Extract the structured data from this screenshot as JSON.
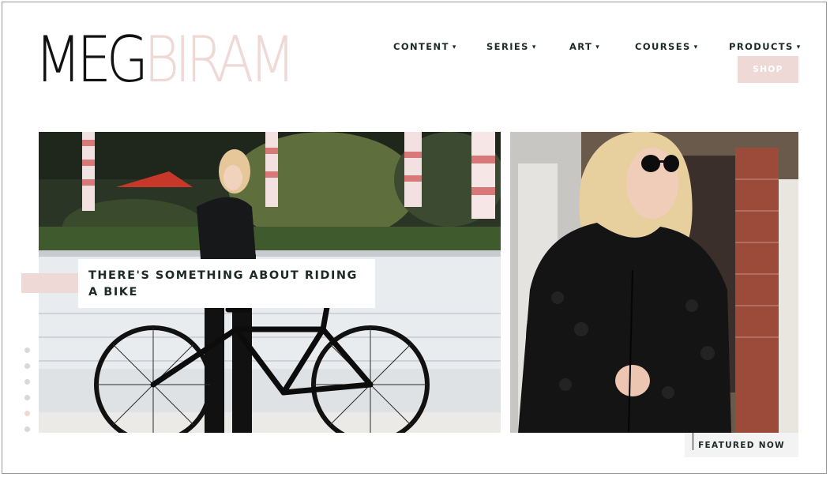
{
  "logo": {
    "first": "MEG",
    "last": "BIRAM"
  },
  "nav": {
    "items": [
      {
        "label": "CONTENT"
      },
      {
        "label": "SERIES"
      },
      {
        "label": "ART"
      },
      {
        "label": "COURSES"
      },
      {
        "label": "PRODUCTS"
      }
    ],
    "chevron": "❯",
    "shop_label": "SHOP"
  },
  "hero": {
    "left": {
      "title": "THERE'S SOMETHING ABOUT RIDING A BIKE"
    },
    "right": {
      "label": "FEATURED NOW"
    }
  },
  "slider": {
    "count": 6,
    "active_index": 4
  },
  "colors": {
    "accent_pink": "#efd9d6",
    "text_dark": "#1c2a24",
    "dot_gray": "#d9d9d9"
  }
}
